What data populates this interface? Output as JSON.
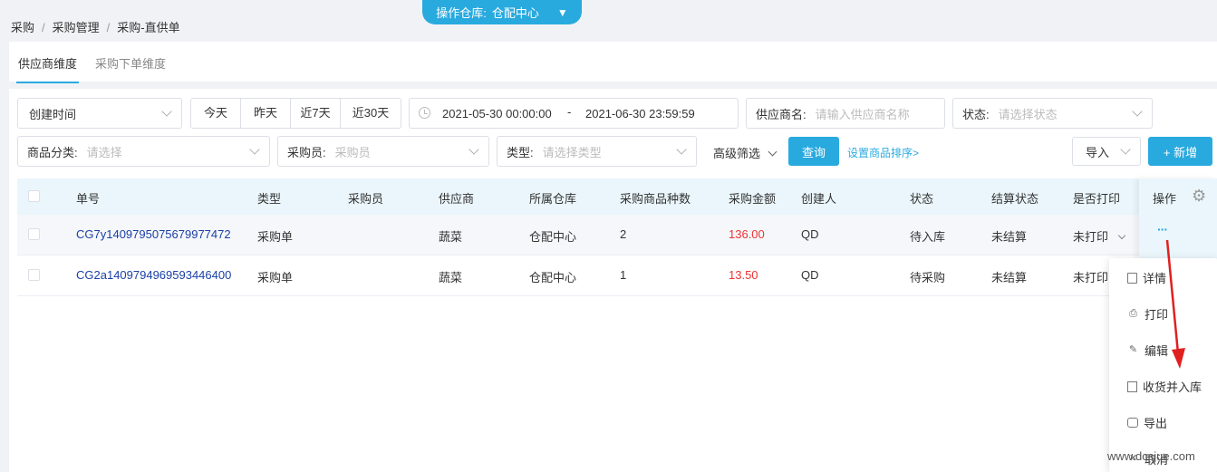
{
  "breadcrumb": [
    "采购",
    "采购管理",
    "采购-直供单"
  ],
  "warehouse": {
    "label": "操作仓库:",
    "value": "仓配中心"
  },
  "tabs": [
    "供应商维度",
    "采购下单维度"
  ],
  "filters": {
    "date_type": "创建时间",
    "quick_ranges": [
      "今天",
      "昨天",
      "近7天",
      "近30天"
    ],
    "date_start": "2021-05-30 00:00:00",
    "date_sep": "-",
    "date_end": "2021-06-30 23:59:59",
    "supplier_label": "供应商名:",
    "supplier_placeholder": "请输入供应商名称",
    "status_label": "状态:",
    "status_placeholder": "请选择状态",
    "category_label": "商品分类:",
    "category_placeholder": "请选择",
    "buyer_label": "采购员:",
    "buyer_placeholder": "采购员",
    "type_label": "类型:",
    "type_placeholder": "请选择类型",
    "advanced": "高级筛选",
    "query": "查询",
    "sort_link": "设置商品排序>",
    "import": "导入",
    "add": "+ 新增"
  },
  "table": {
    "columns": [
      "单号",
      "类型",
      "采购员",
      "供应商",
      "所属仓库",
      "采购商品种数",
      "采购金额",
      "创建人",
      "状态",
      "结算状态",
      "是否打印",
      "操作"
    ],
    "rows": [
      {
        "code": "CG7y1409795075679977472",
        "type": "采购单",
        "buyer": "",
        "supplier": "蔬菜",
        "warehouse": "仓配中心",
        "count": "2",
        "amount": "136.00",
        "creator": "QD",
        "status": "待入库",
        "settle": "未结算",
        "print": "未打印"
      },
      {
        "code": "CG2a1409794969593446400",
        "type": "采购单",
        "buyer": "",
        "supplier": "蔬菜",
        "warehouse": "仓配中心",
        "count": "1",
        "amount": "13.50",
        "creator": "QD",
        "status": "待采购",
        "settle": "未结算",
        "print": "未打印"
      }
    ],
    "more_label": "···"
  },
  "action_menu": [
    {
      "label": "详情",
      "icon": "detail-icon"
    },
    {
      "label": "打印",
      "icon": "printer-icon"
    },
    {
      "label": "编辑",
      "icon": "edit-icon"
    },
    {
      "label": "收货并入库",
      "icon": "receive-icon"
    },
    {
      "label": "导出",
      "icon": "export-icon"
    },
    {
      "label": "取消",
      "icon": "cancel-icon"
    }
  ],
  "watermark": "www.dcsjue.com",
  "colors": {
    "accent": "#29aadf",
    "amount": "#e33333",
    "code_link": "#1a3fa6",
    "annotation_arrow": "#e02020"
  }
}
